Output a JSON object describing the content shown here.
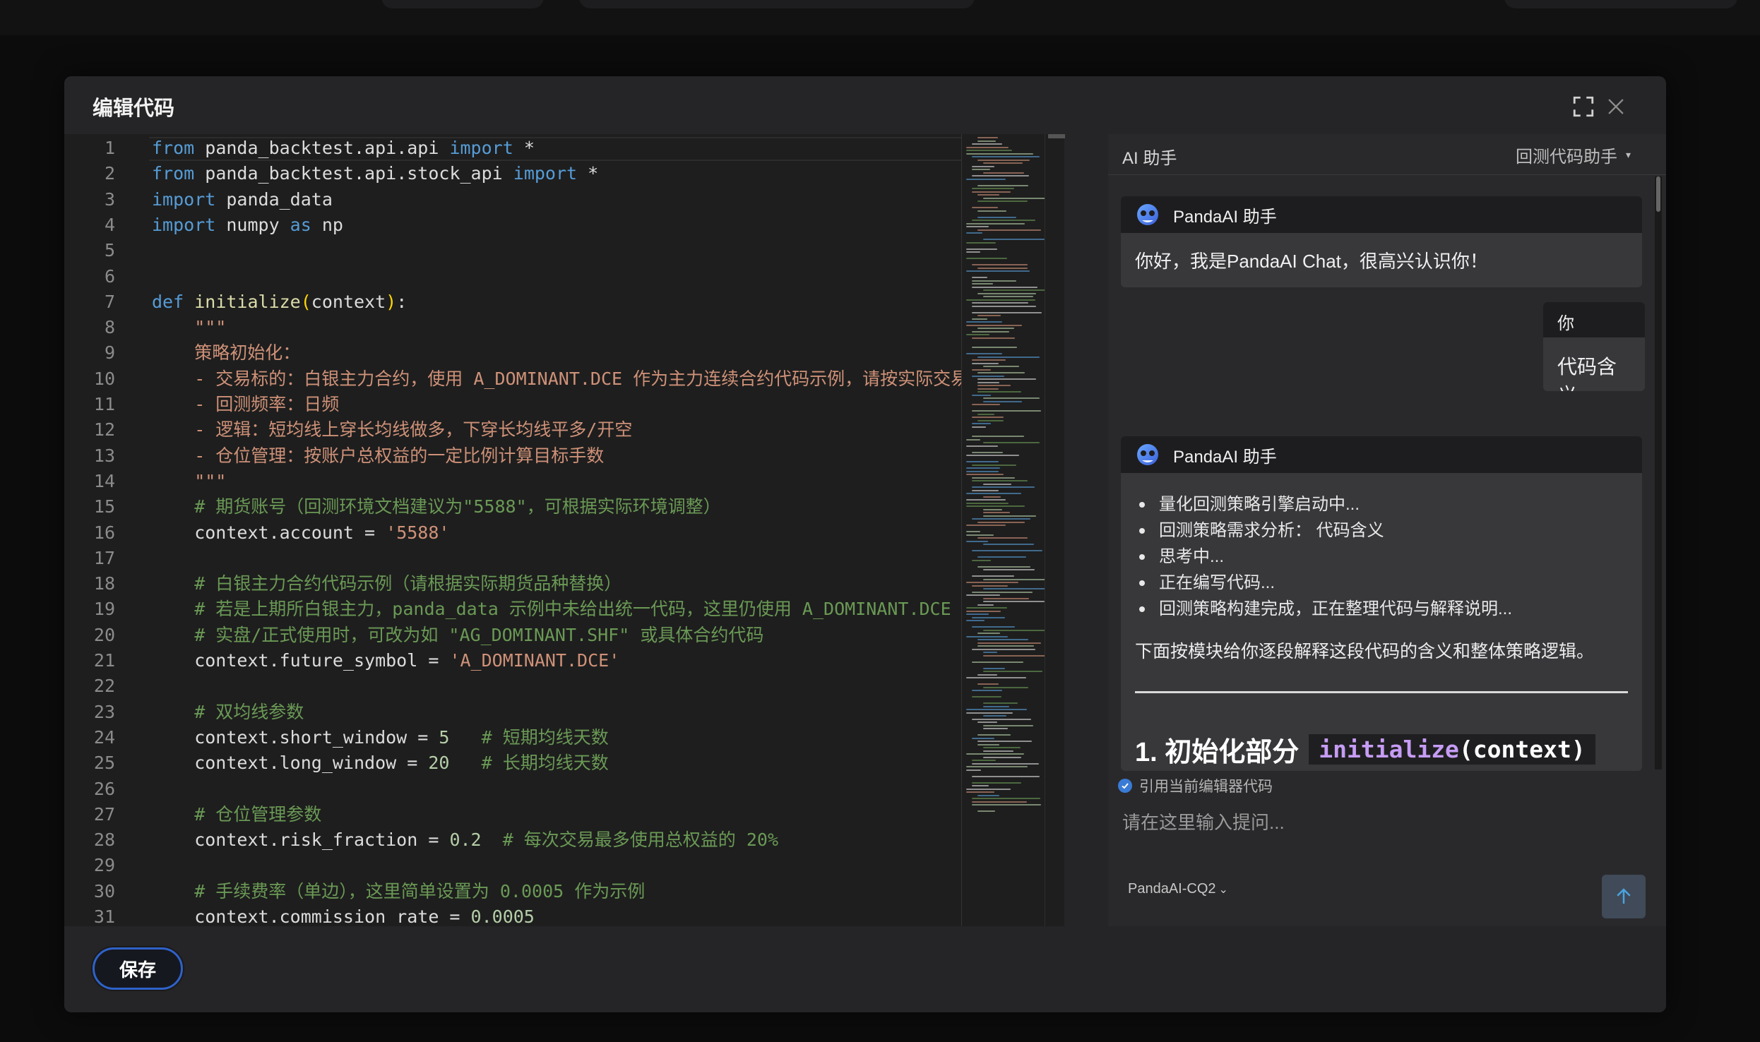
{
  "dialog": {
    "title": "编辑代码",
    "save_label": "保存",
    "icons": {
      "fullscreen": "fullscreen-icon",
      "close": "close-icon"
    }
  },
  "editor": {
    "lines": [
      {
        "n": "1",
        "t": [
          [
            "kw",
            "from"
          ],
          [
            "pl",
            " panda_backtest.api.api "
          ],
          [
            "kw",
            "import"
          ],
          [
            "pl",
            " *"
          ]
        ]
      },
      {
        "n": "2",
        "t": [
          [
            "kw",
            "from"
          ],
          [
            "pl",
            " panda_backtest.api.stock_api "
          ],
          [
            "kw",
            "import"
          ],
          [
            "pl",
            " *"
          ]
        ]
      },
      {
        "n": "3",
        "t": [
          [
            "kw",
            "import"
          ],
          [
            "pl",
            " panda_data"
          ]
        ]
      },
      {
        "n": "4",
        "t": [
          [
            "kw",
            "import"
          ],
          [
            "pl",
            " numpy "
          ],
          [
            "kw",
            "as"
          ],
          [
            "pl",
            " np"
          ]
        ]
      },
      {
        "n": "5",
        "t": []
      },
      {
        "n": "6",
        "t": []
      },
      {
        "n": "7",
        "t": [
          [
            "kw",
            "def"
          ],
          [
            "pl",
            " "
          ],
          [
            "fn",
            "initialize"
          ],
          [
            "br",
            "("
          ],
          [
            "pl",
            "context"
          ],
          [
            "br",
            ")"
          ],
          [
            "pl",
            ":"
          ]
        ]
      },
      {
        "n": "8",
        "t": [
          [
            "doc",
            "    \"\"\""
          ]
        ]
      },
      {
        "n": "9",
        "t": [
          [
            "doc",
            "    策略初始化："
          ]
        ]
      },
      {
        "n": "10",
        "t": [
          [
            "doc",
            "    - 交易标的：白银主力合约，使用 A_DOMINANT.DCE 作为主力连续合约代码示例，请按实际交易所合约"
          ]
        ]
      },
      {
        "n": "11",
        "t": [
          [
            "doc",
            "    - 回测频率：日频"
          ]
        ]
      },
      {
        "n": "12",
        "t": [
          [
            "doc",
            "    - 逻辑：短均线上穿长均线做多，下穿长均线平多/开空"
          ]
        ]
      },
      {
        "n": "13",
        "t": [
          [
            "doc",
            "    - 仓位管理：按账户总权益的一定比例计算目标手数"
          ]
        ]
      },
      {
        "n": "14",
        "t": [
          [
            "doc",
            "    \"\"\""
          ]
        ]
      },
      {
        "n": "15",
        "t": [
          [
            "cm",
            "    # 期货账号（回测环境文档建议为\"5588\"，可根据实际环境调整）"
          ]
        ]
      },
      {
        "n": "16",
        "t": [
          [
            "pl",
            "    context.account = "
          ],
          [
            "str",
            "'5588'"
          ]
        ]
      },
      {
        "n": "17",
        "t": []
      },
      {
        "n": "18",
        "t": [
          [
            "cm",
            "    # 白银主力合约代码示例（请根据实际期货品种替换）"
          ]
        ]
      },
      {
        "n": "19",
        "t": [
          [
            "cm",
            "    # 若是上期所白银主力，panda_data 示例中未给出统一代码，这里仍使用 A_DOMINANT.DCE 作为"
          ]
        ]
      },
      {
        "n": "20",
        "t": [
          [
            "cm",
            "    # 实盘/正式使用时，可改为如 \"AG_DOMINANT.SHF\" 或具体合约代码"
          ]
        ]
      },
      {
        "n": "21",
        "t": [
          [
            "pl",
            "    context.future_symbol = "
          ],
          [
            "str",
            "'A_DOMINANT.DCE'"
          ]
        ]
      },
      {
        "n": "22",
        "t": []
      },
      {
        "n": "23",
        "t": [
          [
            "cm",
            "    # 双均线参数"
          ]
        ]
      },
      {
        "n": "24",
        "t": [
          [
            "pl",
            "    context.short_window = "
          ],
          [
            "num",
            "5"
          ],
          [
            "pl",
            "   "
          ],
          [
            "cm",
            "# 短期均线天数"
          ]
        ]
      },
      {
        "n": "25",
        "t": [
          [
            "pl",
            "    context.long_window = "
          ],
          [
            "num",
            "20"
          ],
          [
            "pl",
            "   "
          ],
          [
            "cm",
            "# 长期均线天数"
          ]
        ]
      },
      {
        "n": "26",
        "t": []
      },
      {
        "n": "27",
        "t": [
          [
            "cm",
            "    # 仓位管理参数"
          ]
        ]
      },
      {
        "n": "28",
        "t": [
          [
            "pl",
            "    context.risk_fraction = "
          ],
          [
            "num",
            "0.2"
          ],
          [
            "pl",
            "  "
          ],
          [
            "cm",
            "# 每次交易最多使用总权益的 20%"
          ]
        ]
      },
      {
        "n": "29",
        "t": []
      },
      {
        "n": "30",
        "t": [
          [
            "cm",
            "    # 手续费率（单边），这里简单设置为 0.0005 作为示例"
          ]
        ]
      },
      {
        "n": "31",
        "t": [
          [
            "pl",
            "    context.commission_rate = "
          ],
          [
            "num",
            "0.0005"
          ]
        ]
      }
    ]
  },
  "chat": {
    "title": "AI 助手",
    "mode_label": "回测代码助手",
    "assistant_name": "PandaAI 助手",
    "greeting": "你好，我是PandaAI Chat，很高兴认识你！",
    "user_label": "你",
    "user_message": "代码含义",
    "progress": [
      "量化回测策略引擎启动中...",
      "回测策略需求分析： 代码含义",
      "思考中...",
      "正在编写代码...",
      "回测策略构建完成，正在整理代码与解释说明..."
    ],
    "intro": "下面按模块给你逐段解释这段代码的含义和整体策略逻辑。",
    "heading_text": "1. 初始化部分",
    "heading_code_fn": "initialize",
    "heading_code_args": "(context)",
    "ref_label": "引用当前编辑器代码",
    "input_placeholder": "请在这里输入提问...",
    "model": "PandaAI-CQ2",
    "icons": {
      "avatar": "panda-logo-icon",
      "send": "send-arrow-icon",
      "check": "check-icon"
    }
  }
}
